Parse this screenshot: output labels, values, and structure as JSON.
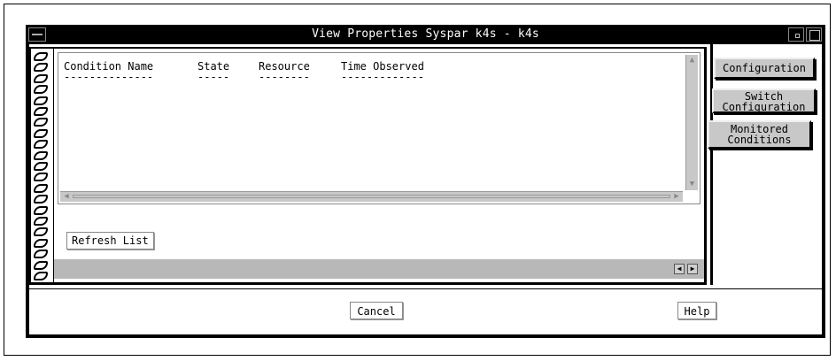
{
  "window": {
    "title": "View Properties Syspar k4s - k4s"
  },
  "list": {
    "columns": [
      "Condition Name",
      "State",
      "Resource",
      "Time Observed"
    ],
    "rules": [
      "--------------",
      "-----",
      "--------",
      "-------------"
    ],
    "rows": []
  },
  "buttons": {
    "refresh": "Refresh List",
    "cancel": "Cancel",
    "help": "Help"
  },
  "tabs": {
    "configuration": "Configuration",
    "switch_line1": "Switch",
    "switch_line2": "Configuration",
    "monitored_line1": "Monitored",
    "monitored_line2": "Conditions",
    "selected": "Monitored Conditions"
  },
  "colors": {
    "titlebar": "#000000",
    "tab_face": "#c8c8c8",
    "scrollbar": "#c8c8c8"
  },
  "icons": [
    "window-menu-icon",
    "minimize-icon",
    "maximize-icon",
    "spiral-binding-icon",
    "arrow-up-icon",
    "arrow-down-icon",
    "arrow-left-icon",
    "arrow-right-icon"
  ]
}
